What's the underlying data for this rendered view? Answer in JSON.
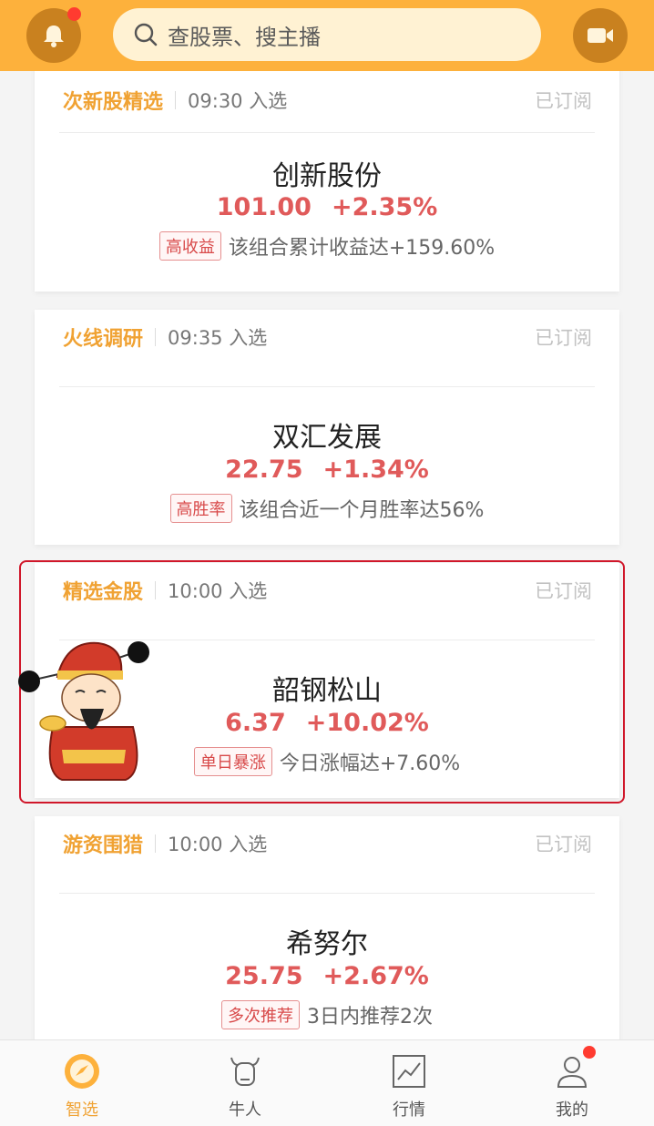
{
  "header": {
    "search_placeholder": "查股票、搜主播",
    "bell_icon": "bell-icon",
    "video_icon": "video-camera-icon"
  },
  "cards": [
    {
      "tag": "次新股精选",
      "time": "09:30 入选",
      "status": "已订阅",
      "stock_name": "创新股份",
      "price": "101.00",
      "change": "+2.35%",
      "badge": "高收益",
      "desc": "该组合累计收益达+159.60%"
    },
    {
      "tag": "火线调研",
      "time": "09:35 入选",
      "status": "已订阅",
      "stock_name": "双汇发展",
      "price": "22.75",
      "change": "+1.34%",
      "badge": "高胜率",
      "desc": "该组合近一个月胜率达56%"
    },
    {
      "tag": "精选金股",
      "time": "10:00 入选",
      "status": "已订阅",
      "stock_name": "韶钢松山",
      "price": "6.37",
      "change": "+10.02%",
      "badge": "单日暴涨",
      "desc": "今日涨幅达+7.60%"
    },
    {
      "tag": "游资围猎",
      "time": "10:00 入选",
      "status": "已订阅",
      "stock_name": "希努尔",
      "price": "25.75",
      "change": "+2.67%",
      "badge": "多次推荐",
      "desc": "3日内推荐2次"
    }
  ],
  "nav": {
    "items": [
      {
        "label": "智选",
        "icon": "smart-pick-icon",
        "active": true
      },
      {
        "label": "牛人",
        "icon": "bull-icon",
        "active": false
      },
      {
        "label": "行情",
        "icon": "market-chart-icon",
        "active": false
      },
      {
        "label": "我的",
        "icon": "profile-icon",
        "active": false
      }
    ]
  },
  "colors": {
    "brand": "#fdb13c",
    "accent": "#f0a233",
    "up": "#e05a5a",
    "highlight_border": "#d0172a"
  }
}
